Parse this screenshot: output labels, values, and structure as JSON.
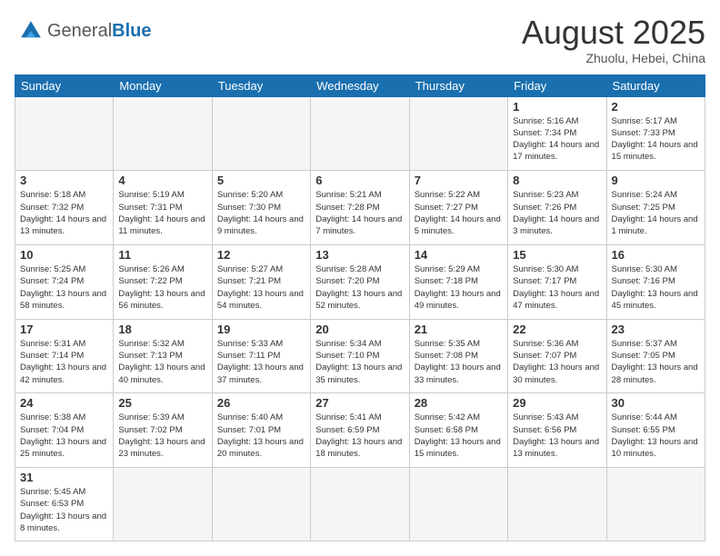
{
  "header": {
    "logo_general": "General",
    "logo_blue": "Blue",
    "month_title": "August 2025",
    "location": "Zhuolu, Hebei, China"
  },
  "weekdays": [
    "Sunday",
    "Monday",
    "Tuesday",
    "Wednesday",
    "Thursday",
    "Friday",
    "Saturday"
  ],
  "weeks": [
    {
      "days": [
        {
          "number": "",
          "info": "",
          "empty": true
        },
        {
          "number": "",
          "info": "",
          "empty": true
        },
        {
          "number": "",
          "info": "",
          "empty": true
        },
        {
          "number": "",
          "info": "",
          "empty": true
        },
        {
          "number": "",
          "info": "",
          "empty": true
        },
        {
          "number": "1",
          "info": "Sunrise: 5:16 AM\nSunset: 7:34 PM\nDaylight: 14 hours\nand 17 minutes."
        },
        {
          "number": "2",
          "info": "Sunrise: 5:17 AM\nSunset: 7:33 PM\nDaylight: 14 hours\nand 15 minutes."
        }
      ]
    },
    {
      "days": [
        {
          "number": "3",
          "info": "Sunrise: 5:18 AM\nSunset: 7:32 PM\nDaylight: 14 hours\nand 13 minutes."
        },
        {
          "number": "4",
          "info": "Sunrise: 5:19 AM\nSunset: 7:31 PM\nDaylight: 14 hours\nand 11 minutes."
        },
        {
          "number": "5",
          "info": "Sunrise: 5:20 AM\nSunset: 7:30 PM\nDaylight: 14 hours\nand 9 minutes."
        },
        {
          "number": "6",
          "info": "Sunrise: 5:21 AM\nSunset: 7:28 PM\nDaylight: 14 hours\nand 7 minutes."
        },
        {
          "number": "7",
          "info": "Sunrise: 5:22 AM\nSunset: 7:27 PM\nDaylight: 14 hours\nand 5 minutes."
        },
        {
          "number": "8",
          "info": "Sunrise: 5:23 AM\nSunset: 7:26 PM\nDaylight: 14 hours\nand 3 minutes."
        },
        {
          "number": "9",
          "info": "Sunrise: 5:24 AM\nSunset: 7:25 PM\nDaylight: 14 hours\nand 1 minute."
        }
      ]
    },
    {
      "days": [
        {
          "number": "10",
          "info": "Sunrise: 5:25 AM\nSunset: 7:24 PM\nDaylight: 13 hours\nand 58 minutes."
        },
        {
          "number": "11",
          "info": "Sunrise: 5:26 AM\nSunset: 7:22 PM\nDaylight: 13 hours\nand 56 minutes."
        },
        {
          "number": "12",
          "info": "Sunrise: 5:27 AM\nSunset: 7:21 PM\nDaylight: 13 hours\nand 54 minutes."
        },
        {
          "number": "13",
          "info": "Sunrise: 5:28 AM\nSunset: 7:20 PM\nDaylight: 13 hours\nand 52 minutes."
        },
        {
          "number": "14",
          "info": "Sunrise: 5:29 AM\nSunset: 7:18 PM\nDaylight: 13 hours\nand 49 minutes."
        },
        {
          "number": "15",
          "info": "Sunrise: 5:30 AM\nSunset: 7:17 PM\nDaylight: 13 hours\nand 47 minutes."
        },
        {
          "number": "16",
          "info": "Sunrise: 5:30 AM\nSunset: 7:16 PM\nDaylight: 13 hours\nand 45 minutes."
        }
      ]
    },
    {
      "days": [
        {
          "number": "17",
          "info": "Sunrise: 5:31 AM\nSunset: 7:14 PM\nDaylight: 13 hours\nand 42 minutes."
        },
        {
          "number": "18",
          "info": "Sunrise: 5:32 AM\nSunset: 7:13 PM\nDaylight: 13 hours\nand 40 minutes."
        },
        {
          "number": "19",
          "info": "Sunrise: 5:33 AM\nSunset: 7:11 PM\nDaylight: 13 hours\nand 37 minutes."
        },
        {
          "number": "20",
          "info": "Sunrise: 5:34 AM\nSunset: 7:10 PM\nDaylight: 13 hours\nand 35 minutes."
        },
        {
          "number": "21",
          "info": "Sunrise: 5:35 AM\nSunset: 7:08 PM\nDaylight: 13 hours\nand 33 minutes."
        },
        {
          "number": "22",
          "info": "Sunrise: 5:36 AM\nSunset: 7:07 PM\nDaylight: 13 hours\nand 30 minutes."
        },
        {
          "number": "23",
          "info": "Sunrise: 5:37 AM\nSunset: 7:05 PM\nDaylight: 13 hours\nand 28 minutes."
        }
      ]
    },
    {
      "days": [
        {
          "number": "24",
          "info": "Sunrise: 5:38 AM\nSunset: 7:04 PM\nDaylight: 13 hours\nand 25 minutes."
        },
        {
          "number": "25",
          "info": "Sunrise: 5:39 AM\nSunset: 7:02 PM\nDaylight: 13 hours\nand 23 minutes."
        },
        {
          "number": "26",
          "info": "Sunrise: 5:40 AM\nSunset: 7:01 PM\nDaylight: 13 hours\nand 20 minutes."
        },
        {
          "number": "27",
          "info": "Sunrise: 5:41 AM\nSunset: 6:59 PM\nDaylight: 13 hours\nand 18 minutes."
        },
        {
          "number": "28",
          "info": "Sunrise: 5:42 AM\nSunset: 6:58 PM\nDaylight: 13 hours\nand 15 minutes."
        },
        {
          "number": "29",
          "info": "Sunrise: 5:43 AM\nSunset: 6:56 PM\nDaylight: 13 hours\nand 13 minutes."
        },
        {
          "number": "30",
          "info": "Sunrise: 5:44 AM\nSunset: 6:55 PM\nDaylight: 13 hours\nand 10 minutes."
        }
      ]
    },
    {
      "days": [
        {
          "number": "31",
          "info": "Sunrise: 5:45 AM\nSunset: 6:53 PM\nDaylight: 13 hours\nand 8 minutes."
        },
        {
          "number": "",
          "info": "",
          "empty": true
        },
        {
          "number": "",
          "info": "",
          "empty": true
        },
        {
          "number": "",
          "info": "",
          "empty": true
        },
        {
          "number": "",
          "info": "",
          "empty": true
        },
        {
          "number": "",
          "info": "",
          "empty": true
        },
        {
          "number": "",
          "info": "",
          "empty": true
        }
      ]
    }
  ]
}
